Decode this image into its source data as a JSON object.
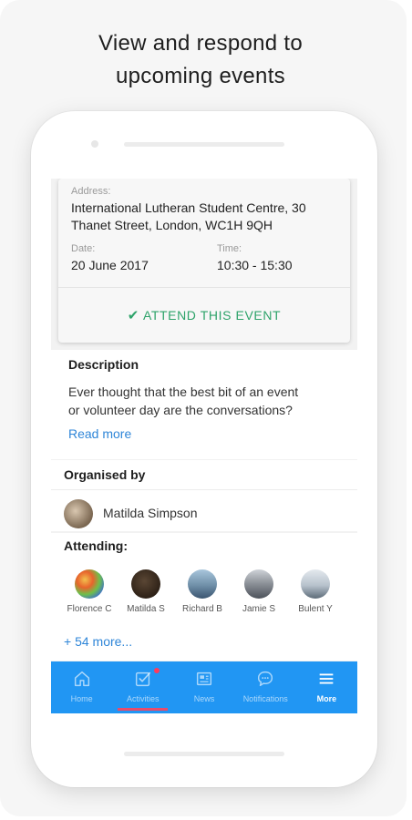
{
  "headline": {
    "line1": "View and respond to",
    "line2": "upcoming events"
  },
  "event": {
    "address_label": "Address:",
    "address_line1": "International Lutheran Student Centre, 30",
    "address_line2": "Thanet Street, London, WC1H 9QH",
    "date_label": "Date:",
    "date_value": "20 June 2017",
    "time_label": "Time:",
    "time_value": "10:30 - 15:30",
    "attend_label": "ATTEND THIS EVENT",
    "attend_icon": "checkmark-icon"
  },
  "description": {
    "title": "Description",
    "line1": "Ever thought that the best bit of an event",
    "line2": "or volunteer day are the conversations?",
    "read_more": "Read more"
  },
  "organiser": {
    "title": "Organised by",
    "name": "Matilda Simpson"
  },
  "attending": {
    "title": "Attending:",
    "people": [
      {
        "name": "Florence C",
        "color": "#c8502a"
      },
      {
        "name": "Matilda S",
        "color": "#3a2a1c"
      },
      {
        "name": "Richard B",
        "color": "#6f8fa8"
      },
      {
        "name": "Jamie S",
        "color": "#8a8f96"
      },
      {
        "name": "Bulent Y",
        "color": "#b7c2cc"
      }
    ],
    "more": "+ 54 more..."
  },
  "tabs": [
    {
      "label": "Home",
      "icon": "home-icon"
    },
    {
      "label": "Activities",
      "icon": "activities-icon"
    },
    {
      "label": "News",
      "icon": "news-icon"
    },
    {
      "label": "Notifications",
      "icon": "chat-bubble-icon"
    },
    {
      "label": "More",
      "icon": "menu-icon"
    }
  ],
  "colors": {
    "accent_blue": "#2196f3",
    "attend_green": "#2ea36a",
    "link_blue": "#2f86d8",
    "badge_red": "#ff3b5c"
  }
}
